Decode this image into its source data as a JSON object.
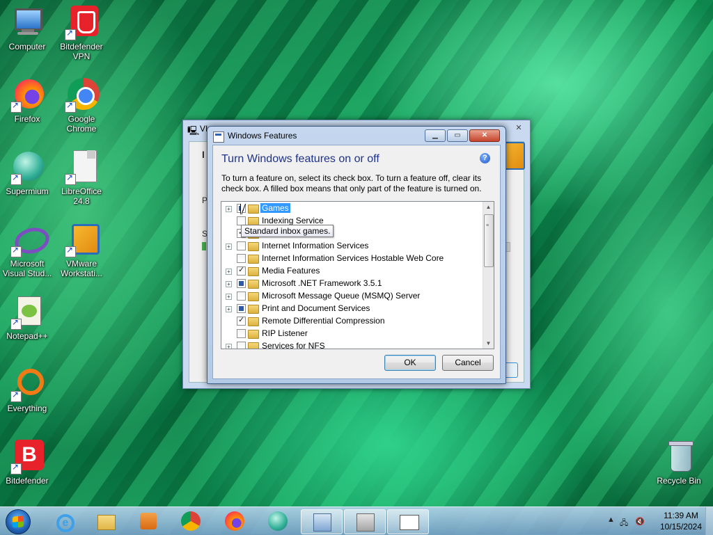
{
  "desktop": {
    "icons": [
      {
        "label": "Computer"
      },
      {
        "label": "Bitdefender VPN"
      },
      {
        "label": "Firefox"
      },
      {
        "label": "Google Chrome"
      },
      {
        "label": "Supermium"
      },
      {
        "label": "LibreOffice 24.8"
      },
      {
        "label": "Microsoft Visual Stud..."
      },
      {
        "label": "VMware Workstati..."
      },
      {
        "label": "Notepad++"
      },
      {
        "label": "Everything"
      },
      {
        "label": "Bitdefender"
      },
      {
        "label": "Recycle Bin"
      }
    ]
  },
  "background_dialog": {
    "title": "VI",
    "letter_1": "I",
    "letter_2": "P",
    "letter_3": "S"
  },
  "windows_features": {
    "title": "Windows Features",
    "heading": "Turn Windows features on or off",
    "description": "To turn a feature on, select its check box. To turn a feature off, clear its check box. A filled box means that only part of the feature is turned on.",
    "tooltip": "Standard inbox games.",
    "ok_label": "OK",
    "cancel_label": "Cancel",
    "features": [
      {
        "label": "Games",
        "state": "partial",
        "expandable": true,
        "selected": true
      },
      {
        "label": "Indexing Service",
        "state": "unchecked",
        "expandable": false
      },
      {
        "label": "",
        "state": "checked",
        "expandable": false
      },
      {
        "label": "Internet Information Services",
        "state": "unchecked",
        "expandable": true
      },
      {
        "label": "Internet Information Services Hostable Web Core",
        "state": "unchecked",
        "expandable": false
      },
      {
        "label": "Media Features",
        "state": "checked",
        "expandable": true
      },
      {
        "label": "Microsoft .NET Framework 3.5.1",
        "state": "partial",
        "expandable": true
      },
      {
        "label": "Microsoft Message Queue (MSMQ) Server",
        "state": "unchecked",
        "expandable": true
      },
      {
        "label": "Print and Document Services",
        "state": "partial",
        "expandable": true
      },
      {
        "label": "Remote Differential Compression",
        "state": "checked",
        "expandable": false
      },
      {
        "label": "RIP Listener",
        "state": "unchecked",
        "expandable": false
      },
      {
        "label": "Services for NFS",
        "state": "unchecked",
        "expandable": true
      }
    ]
  },
  "taskbar": {
    "time": "11:39 AM",
    "date": "10/15/2024"
  }
}
